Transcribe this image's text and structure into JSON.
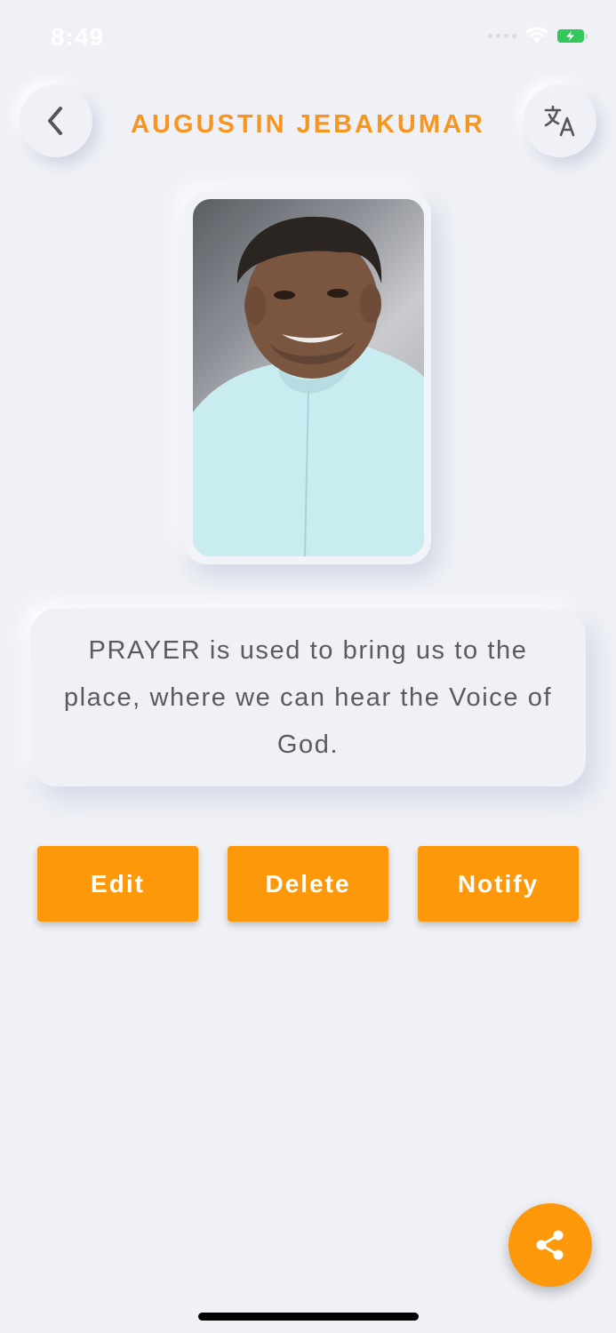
{
  "status_bar": {
    "time": "8:49"
  },
  "header": {
    "title": "AUGUSTIN JEBAKUMAR"
  },
  "icons": {
    "back": "chevron-left-icon",
    "translate": "translate-icon",
    "share": "share-icon"
  },
  "quote": {
    "text": "PRAYER is used to bring us to the place, where we can hear the Voice of God."
  },
  "actions": {
    "edit_label": "Edit",
    "delete_label": "Delete",
    "notify_label": "Notify"
  },
  "colors": {
    "accent": "#fe980b",
    "title": "#f7951f",
    "background": "#eff1f6",
    "quote_text": "#5b5b5b"
  }
}
